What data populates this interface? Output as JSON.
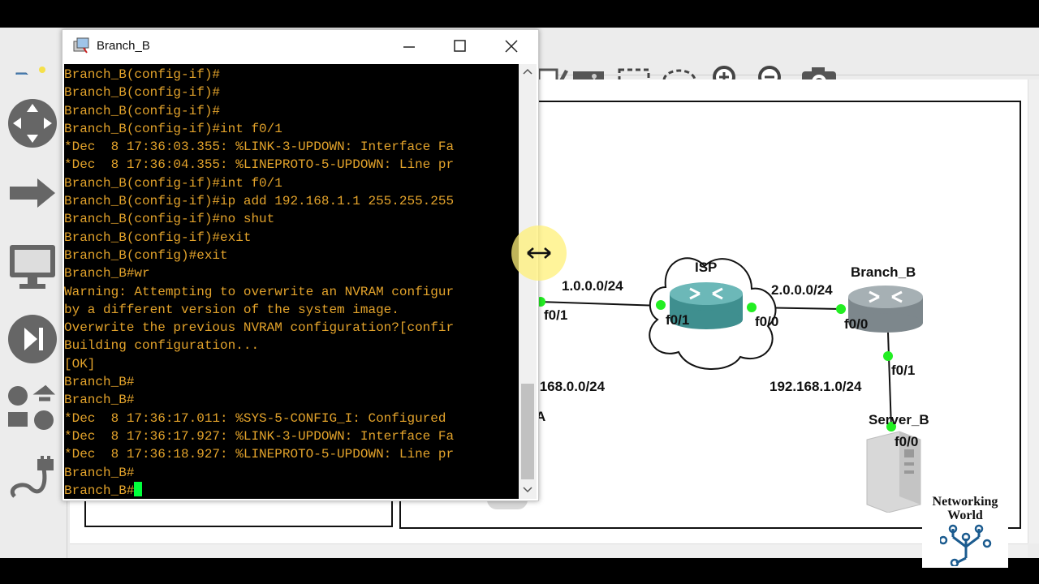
{
  "colors": {
    "terminal_bg": "#000000",
    "terminal_text": "#e3a32b",
    "cursor": "#00ff3c",
    "link_dot": "#22ee22",
    "router_body": "#3f8f8f",
    "router_gray": "#8a9499"
  },
  "terminal_window": {
    "title": "Branch_B",
    "icon": "putty-icon",
    "controls": [
      "minimize-icon",
      "maximize-icon",
      "close-icon"
    ],
    "lines": [
      "Branch_B(config-if)#",
      "Branch_B(config-if)#",
      "Branch_B(config-if)#",
      "Branch_B(config-if)#int f0/1",
      "*Dec  8 17:36:03.355: %LINK-3-UPDOWN: Interface Fa",
      "*Dec  8 17:36:04.355: %LINEPROTO-5-UPDOWN: Line pr",
      "Branch_B(config-if)#int f0/1",
      "Branch_B(config-if)#ip add 192.168.1.1 255.255.255",
      "Branch_B(config-if)#no shut",
      "Branch_B(config-if)#exit",
      "Branch_B(config)#exit",
      "Branch_B#wr",
      "Warning: Attempting to overwrite an NVRAM configur",
      "by a different version of the system image.",
      "Overwrite the previous NVRAM configuration?[confir",
      "Building configuration...",
      "[OK]",
      "Branch_B#",
      "Branch_B#",
      "*Dec  8 17:36:17.011: %SYS-5-CONFIG_I: Configured",
      "*Dec  8 17:36:17.927: %LINK-3-UPDOWN: Interface Fa",
      "*Dec  8 17:36:18.927: %LINEPROTO-5-UPDOWN: Line pr",
      "Branch_B#",
      "Branch_B#"
    ]
  },
  "toolbar": {
    "icons": [
      "open-folder-icon",
      "edit-note-icon",
      "insert-picture-icon",
      "rectangle-icon",
      "ellipse-icon",
      "zoom-in-icon",
      "zoom-out-icon",
      "screenshot-icon"
    ]
  },
  "dock": {
    "icons": [
      "routers-icon",
      "switches-icon",
      "end-devices-icon",
      "security-devices-icon",
      "all-devices-icon",
      "add-link-icon"
    ]
  },
  "topology": {
    "isp_label": "ISP",
    "branch_label": "Branch_B",
    "server_label": "Server_B",
    "partial_a_label": "A",
    "net_1": "1.0.0.0/24",
    "net_2": "2.0.0.0/24",
    "net_3": "192.168.1.0/24",
    "net_4": ".168.0.0/24",
    "if_left_f01": "f0/1",
    "if_isp_f01": "f0/1",
    "if_isp_f00": "f0/0",
    "if_branch_f00": "f0/0",
    "if_branch_f01": "f0/1",
    "if_server_f00": "f0/0"
  },
  "logo": {
    "line1": "Networking",
    "line2": "World"
  }
}
